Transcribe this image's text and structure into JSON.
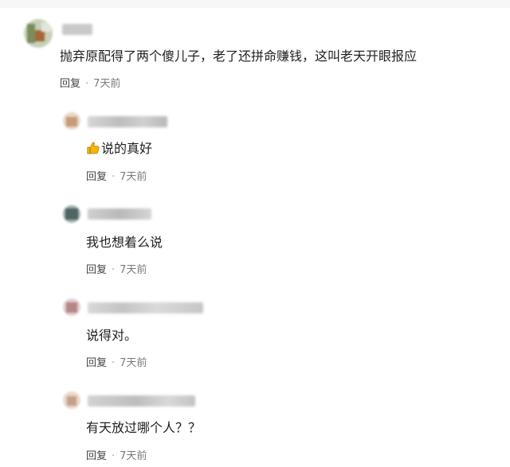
{
  "top_comment": {
    "text": "抛弃原配得了两个傻儿子，老了还拼命赚钱，这叫老天开眼报应",
    "reply_label": "回复",
    "separator": "·",
    "time": "7天前"
  },
  "replies": [
    {
      "emoji_icon": "thumbs-up-icon",
      "text": "说的真好",
      "reply_label": "回复",
      "separator": "·",
      "time": "7天前"
    },
    {
      "text": "我也想着么说",
      "reply_label": "回复",
      "separator": "·",
      "time": "7天前"
    },
    {
      "text": "说得对。",
      "reply_label": "回复",
      "separator": "·",
      "time": "7天前"
    },
    {
      "text": "有天放过哪个人？？",
      "reply_label": "回复",
      "separator": "·",
      "time": "7天前"
    }
  ],
  "colors": {
    "text": "#1f1f1f",
    "meta": "#7a7a7a",
    "emoji": "#f5b400"
  }
}
